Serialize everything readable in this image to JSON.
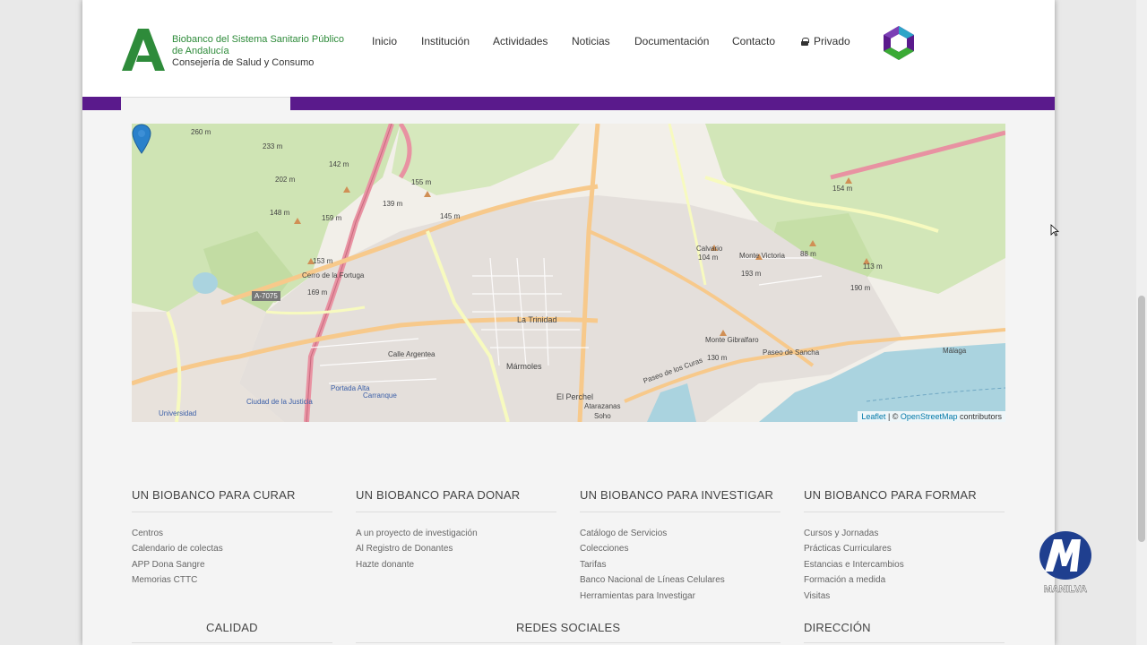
{
  "header": {
    "brand": {
      "line1": "Biobanco del Sistema Sanitario Público",
      "line2": "de Andalucía",
      "line3": "Consejería de Salud y Consumo"
    },
    "nav": [
      {
        "label": "Inicio"
      },
      {
        "label": "Institución"
      },
      {
        "label": "Actividades"
      },
      {
        "label": "Noticias"
      },
      {
        "label": "Documentación"
      },
      {
        "label": "Contacto"
      },
      {
        "label": "Privado",
        "icon": "lock-icon"
      }
    ],
    "colors": {
      "brand_green": "#2e8b3a",
      "accent_purple": "#5a1a8c"
    }
  },
  "map": {
    "labels": {
      "trinidad": "La Trinidad",
      "marmoles": "Mármoles",
      "perchel": "El Perchel",
      "atarazanas": "Atarazanas",
      "soho": "Soho",
      "portada_alta": "Portada Alta",
      "carranque": "Carranque",
      "ciudad_justicia": "Ciudad de la Justicia",
      "universidad": "Universidad",
      "calvario": "Calvario",
      "calvario_h": "104 m",
      "monte_victoria": "Monte Victoria",
      "monte_victoria_h": "193 m",
      "monte_gibralfaro": "Monte Gibralfaro",
      "gibralfaro_h": "130 m",
      "cerro_tortuga": "Cerro de la Fortuga",
      "cerro_tortuga_h": "169 m",
      "paseo_sancha": "Paseo de Sancha",
      "paseo_curas": "Paseo de los Curas",
      "calle_argentea": "Calle Argentea",
      "road_a7075": "A-7075",
      "malaga": "Málaga",
      "elev_260": "260 m",
      "elev_233": "233 m",
      "elev_202": "202 m",
      "elev_142": "142 m",
      "elev_155": "155 m",
      "elev_139": "139 m",
      "elev_145": "145 m",
      "elev_148": "148 m",
      "elev_159": "159 m",
      "elev_153": "153 m",
      "elev_88": "88 m",
      "elev_113": "113 m",
      "elev_154": "154 m",
      "elev_190": "190 m"
    },
    "attribution": {
      "leaflet": "Leaflet",
      "sep": " | © ",
      "osm": "OpenStreetMap",
      "suffix": " contributors"
    }
  },
  "footer": {
    "columns": [
      {
        "title": "UN BIOBANCO PARA CURAR",
        "links": [
          "Centros",
          "Calendario de colectas",
          "APP Dona Sangre",
          "Memorias CTTC"
        ]
      },
      {
        "title": "UN BIOBANCO PARA DONAR",
        "links": [
          "A un proyecto de investigación",
          "Al Registro de Donantes",
          "Hazte donante"
        ]
      },
      {
        "title": "UN BIOBANCO PARA INVESTIGAR",
        "links": [
          "Catálogo de Servicios",
          "Colecciones",
          "Tarifas",
          "Banco Nacional de Líneas Celulares",
          "Herramientas para Investigar"
        ]
      },
      {
        "title": "UN BIOBANCO PARA FORMAR",
        "links": [
          "Cursos y Jornadas",
          "Prácticas Curriculares",
          "Estancias e Intercambios",
          "Formación a medida",
          "Visitas"
        ]
      }
    ],
    "row2": {
      "calidad": "CALIDAD",
      "redes": "REDES SOCIALES",
      "direccion": "DIRECCIÓN"
    }
  },
  "watermark": {
    "text": "MANILVA"
  }
}
